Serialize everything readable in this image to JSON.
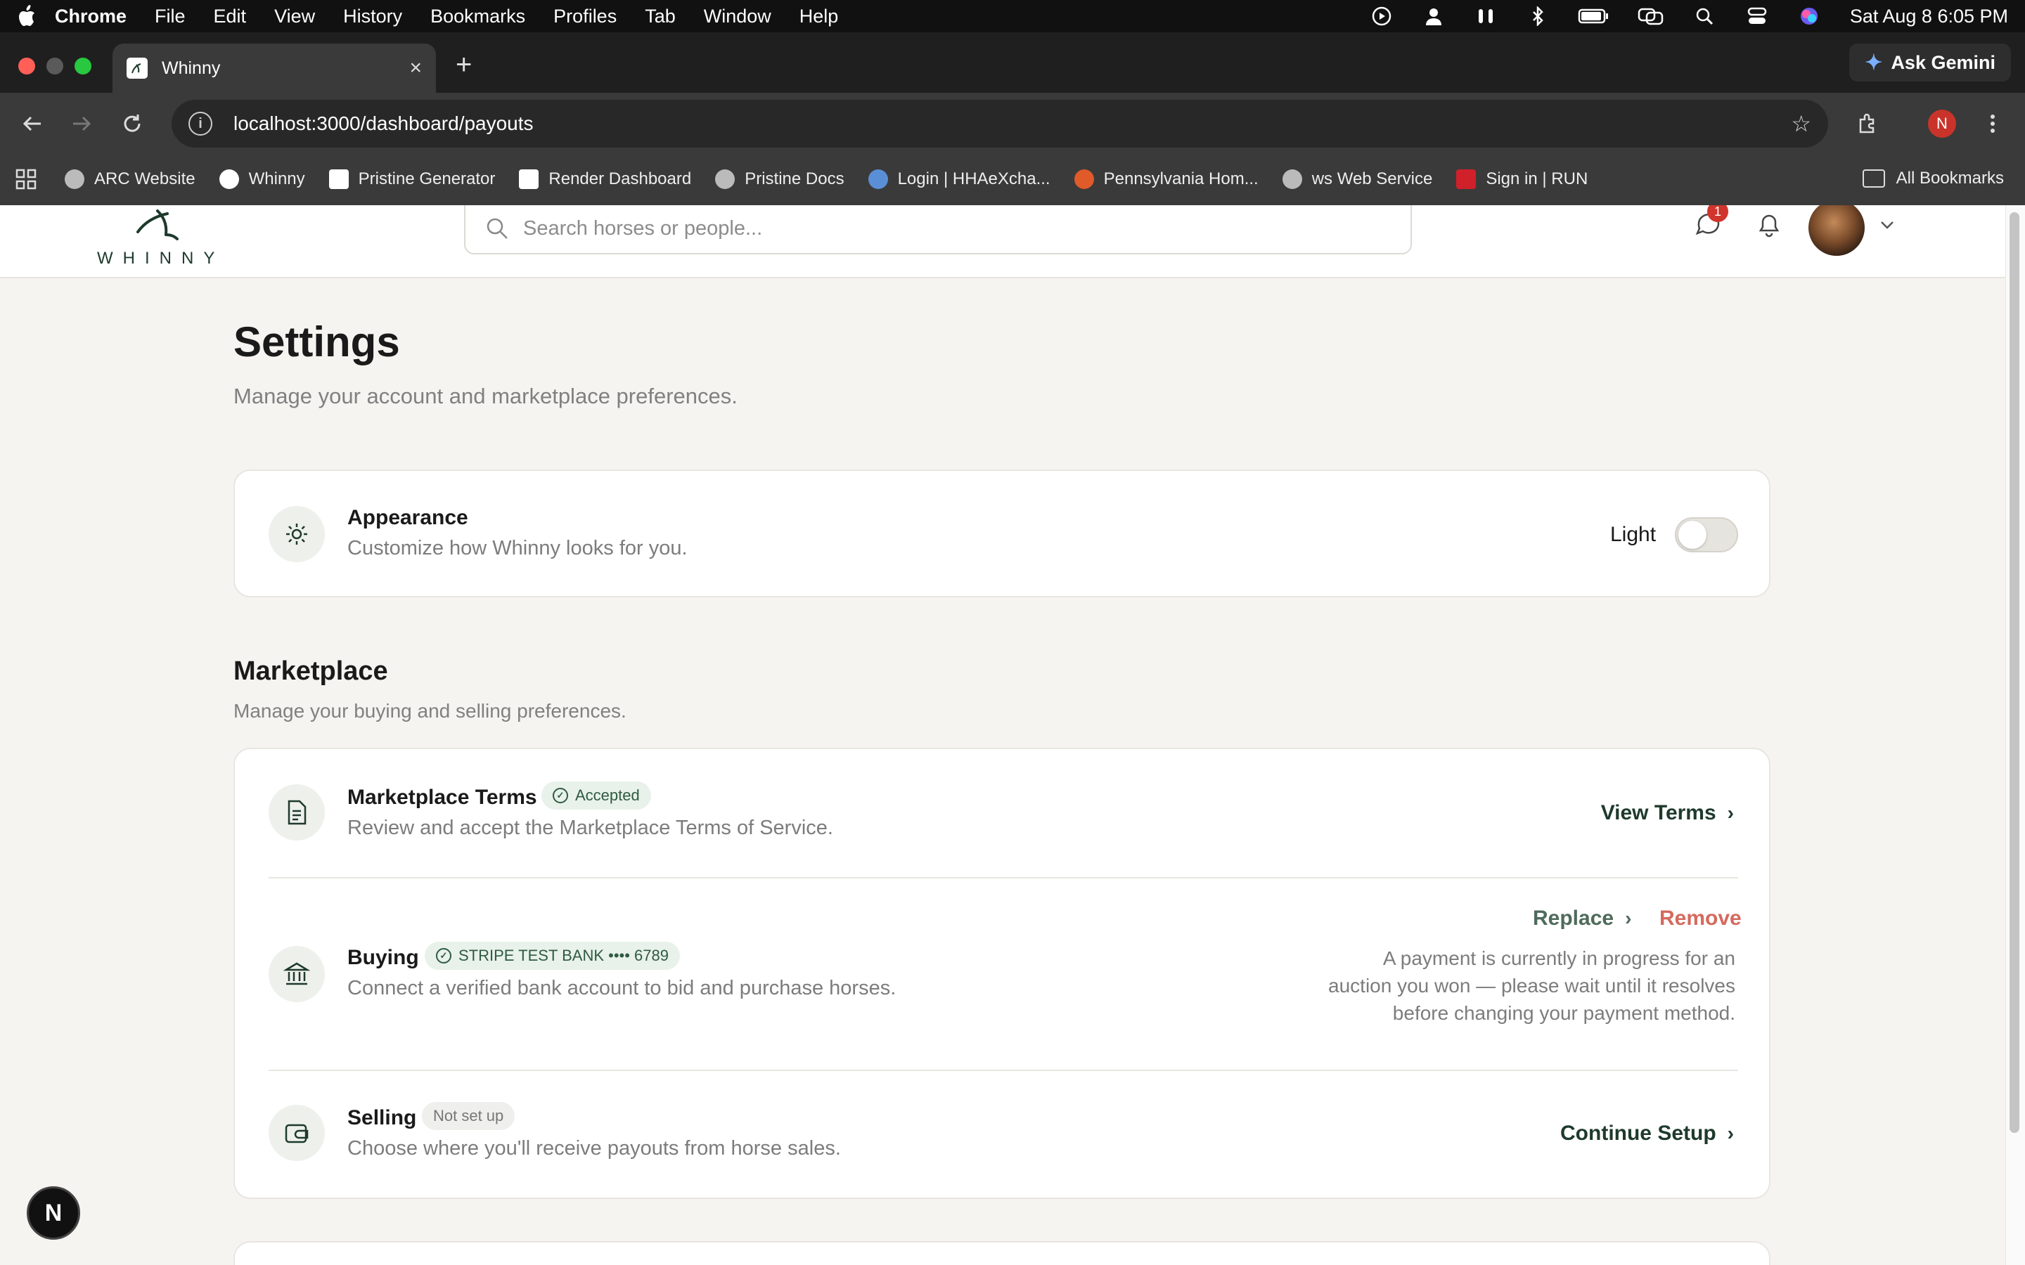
{
  "menubar": {
    "app": "Chrome",
    "items": [
      "File",
      "Edit",
      "View",
      "History",
      "Bookmarks",
      "Profiles",
      "Tab",
      "Window",
      "Help"
    ],
    "clock": "Sat Aug 8  6:05 PM"
  },
  "browser": {
    "tab_title": "Whinny",
    "gemini_label": "Ask Gemini",
    "url": "localhost:3000/dashboard/payouts",
    "profile_initial": "N",
    "bookmarks": [
      "ARC Website",
      "Whinny",
      "Pristine Generator",
      "Render Dashboard",
      "Pristine Docs",
      "Login | HHAeXcha...",
      "Pennsylvania Hom...",
      "ws Web Service",
      "Sign in | RUN"
    ],
    "all_bookmarks": "All Bookmarks"
  },
  "header": {
    "logo_text": "WHINNY",
    "search_placeholder": "Search horses or people...",
    "message_badge": "1"
  },
  "page": {
    "title": "Settings",
    "subtitle": "Manage your account and marketplace preferences."
  },
  "appearance": {
    "title": "Appearance",
    "description": "Customize how Whinny looks for you.",
    "mode_label": "Light"
  },
  "marketplace": {
    "title": "Marketplace",
    "subtitle": "Manage your buying and selling preferences.",
    "terms": {
      "title": "Marketplace Terms",
      "badge": "Accepted",
      "description": "Review and accept the Marketplace Terms of Service.",
      "action": "View Terms"
    },
    "buying": {
      "title": "Buying",
      "badge": "STRIPE TEST BANK •••• 6789",
      "description": "Connect a verified bank account to bid and purchase horses.",
      "replace": "Replace",
      "remove": "Remove",
      "notice_lines": [
        "A payment is currently in progress for an",
        "auction you won — please wait until it resolves",
        "before changing your payment method."
      ]
    },
    "selling": {
      "title": "Selling",
      "badge": "Not set up",
      "description": "Choose where you'll receive payouts from horse sales.",
      "action": "Continue Setup"
    }
  },
  "dev_badge": "N",
  "colors": {
    "brand": "#1e3a2c",
    "remove": "#d46a5e",
    "accepted_bg": "#e8f1ea"
  }
}
